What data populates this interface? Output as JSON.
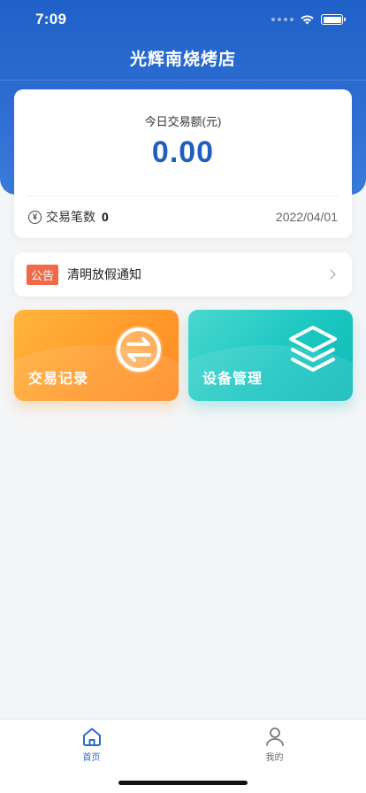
{
  "status_bar": {
    "time": "7:09"
  },
  "header": {
    "title": "光辉南烧烤店"
  },
  "summary": {
    "label": "今日交易额(元)",
    "amount": "0.00",
    "count_label": "交易笔数",
    "count_value": "0",
    "date": "2022/04/01"
  },
  "notice": {
    "badge": "公告",
    "text": "清明放假通知"
  },
  "tiles": [
    {
      "label": "交易记录",
      "icon": "exchange-icon",
      "color": "#ff9a2c"
    },
    {
      "label": "设备管理",
      "icon": "layers-icon",
      "color": "#1cc7c2"
    }
  ],
  "tab_bar": {
    "items": [
      {
        "label": "首页",
        "icon": "home-icon",
        "active": true
      },
      {
        "label": "我的",
        "icon": "user-icon",
        "active": false
      }
    ]
  },
  "colors": {
    "primary": "#1f61c8",
    "accent_orange": "#ef6a47"
  }
}
